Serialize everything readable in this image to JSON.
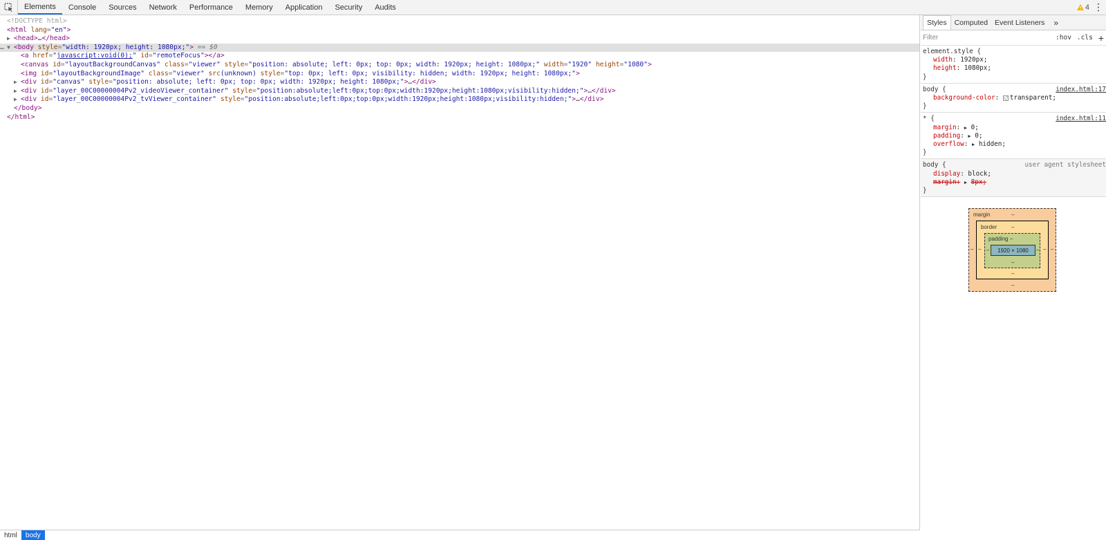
{
  "toolbar": {
    "tabs": [
      "Elements",
      "Console",
      "Sources",
      "Network",
      "Performance",
      "Memory",
      "Application",
      "Security",
      "Audits"
    ],
    "warning_count": "4"
  },
  "dom": {
    "doctype": "<!DOCTYPE html>",
    "html_open_tag": "html",
    "html_lang_attr": "lang",
    "html_lang_val": "\"en\"",
    "head_collapsed": "head",
    "head_ellipsis": "…",
    "body_style_val": "\"width: 1920px; height: 1080px;\"",
    "body_eq": "== $0",
    "a_href_val": "javascript:void(0);",
    "a_id_val": "\"remoteFocus\"",
    "canvas_id_val": "\"layoutBackgroundCanvas\"",
    "canvas_class_val": "\"viewer\"",
    "canvas_style_val": "\"position: absolute; left: 0px; top: 0px; width: 1920px; height: 1080px;\"",
    "canvas_width_val": "\"1920\"",
    "canvas_height_val": "\"1080\"",
    "img_id_val": "\"layoutBackgroundImage\"",
    "img_class_val": "\"viewer\"",
    "img_src_val": "(unknown)",
    "img_style_val": "\"top: 0px; left: 0px; visibility: hidden; width: 1920px; height: 1080px;\"",
    "div1_id_val": "\"canvas\"",
    "div1_style_val": "\"position: absolute; left: 0px; top: 0px; width: 1920px; height: 1080px;\"",
    "div2_id_val": "\"layer_00C00000004Pv2_videoViewer_container\"",
    "div2_style_val": "\"position:absolute;left:0px;top:0px;width:1920px;height:1080px;visibility:hidden;\"",
    "div3_id_val": "\"layer_00C00000004Pv2_tvViewer_container\"",
    "div3_style_val": "\"position:absolute;left:0px;top:0px;width:1920px;height:1080px;visibility:hidden;\""
  },
  "breadcrumb": [
    "html",
    "body"
  ],
  "sidebar": {
    "tabs": [
      "Styles",
      "Computed",
      "Event Listeners"
    ],
    "filter_placeholder": "Filter",
    "hov": ":hov",
    "cls": ".cls",
    "rules": {
      "element_selector": "element.style {",
      "element_w_name": "width",
      "element_w_val": "1920px;",
      "element_h_name": "height",
      "element_h_val": "1080px;",
      "body1_selector": "body {",
      "body1_src": "index.html:17",
      "body1_prop": "background-color",
      "body1_val": "transparent;",
      "star_selector": "* {",
      "star_src": "index.html:11",
      "star_margin": "margin",
      "star_margin_val": "0;",
      "star_padding": "padding",
      "star_padding_val": "0;",
      "star_overflow": "overflow",
      "star_overflow_val": "hidden;",
      "ua_selector": "body {",
      "ua_src": "user agent stylesheet",
      "ua_display": "display",
      "ua_display_val": "block;",
      "ua_margin": "margin",
      "ua_margin_val": "8px;"
    },
    "boxmodel": {
      "margin_label": "margin",
      "border_label": "border",
      "padding_label": "padding",
      "dash": "–",
      "content": "1920 × 1080"
    }
  }
}
